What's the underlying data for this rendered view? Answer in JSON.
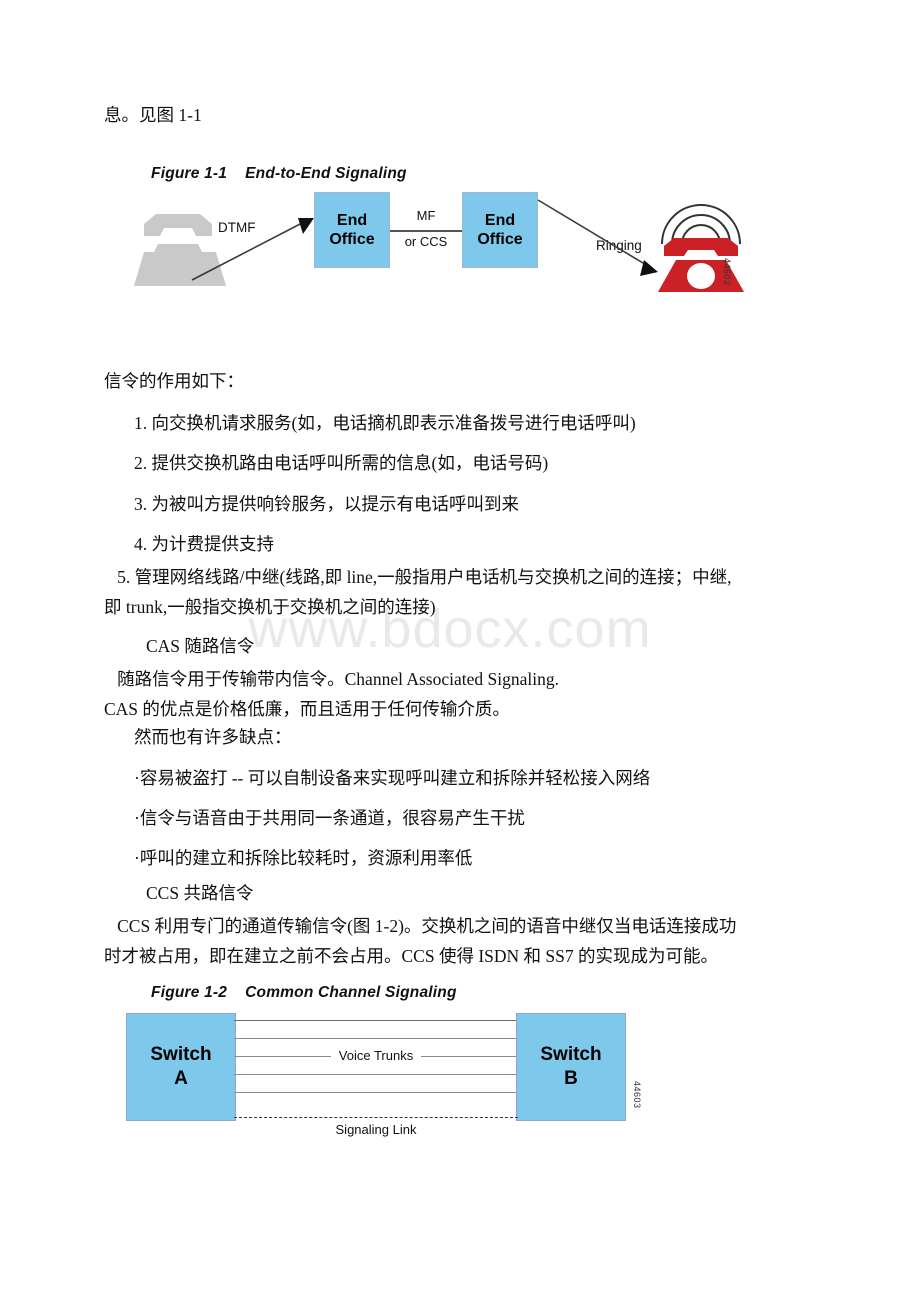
{
  "document": {
    "watermark": "www.bdocx.com",
    "paragraphs": [
      {
        "id": "p-intro",
        "text": "息。见图 1-1"
      },
      {
        "id": "p-roles-heading",
        "text": "信令的作用如下："
      },
      {
        "id": "p-role-1",
        "text": "1. 向交换机请求服务(如，电话摘机即表示准备拨号进行电话呼叫)"
      },
      {
        "id": "p-role-2",
        "text": "2. 提供交换机路由电话呼叫所需的信息(如，电话号码)"
      },
      {
        "id": "p-role-3",
        "text": "3. 为被叫方提供响铃服务，以提示有电话呼叫到来"
      },
      {
        "id": "p-role-4",
        "text": "4. 为计费提供支持"
      },
      {
        "id": "p-role-5",
        "text": "   5. 管理网络线路/中继(线路,即 line,一般指用户电话机与交换机之间的连接；中继,\n即 trunk,一般指交换机于交换机之间的连接)"
      },
      {
        "id": "p-cas-heading",
        "text": "CAS 随路信令"
      },
      {
        "id": "p-cas-body",
        "text": "   随路信令用于传输带内信令。Channel Associated Signaling.\nCAS 的优点是价格低廉，而且适用于任何传输介质。"
      },
      {
        "id": "p-drawbacks-heading",
        "text": "然而也有许多缺点："
      },
      {
        "id": "p-drawback-1",
        "text": "·容易被盗打 -- 可以自制设备来实现呼叫建立和拆除并轻松接入网络"
      },
      {
        "id": "p-drawback-2",
        "text": "·信令与语音由于共用同一条通道，很容易产生干扰"
      },
      {
        "id": "p-drawback-3",
        "text": "·呼叫的建立和拆除比较耗时，资源利用率低"
      },
      {
        "id": "p-ccs-heading",
        "text": "CCS 共路信令"
      },
      {
        "id": "p-ccs-body",
        "text": "   CCS 利用专门的通道传输信令(图 1-2)。交换机之间的语音中继仅当电话连接成功\n时才被占用，即在建立之前不会占用。CCS 使得 ISDN 和 SS7 的实现成为可能。"
      }
    ]
  },
  "figure1": {
    "caption_number": "Figure 1-1",
    "caption_title": "End-to-End Signaling",
    "figure_id": "44602",
    "nodes": [
      {
        "id": "end-office-1",
        "label_line1": "End",
        "label_line2": "Office"
      },
      {
        "id": "end-office-2",
        "label_line1": "End",
        "label_line2": "Office"
      }
    ],
    "links": {
      "dtmf": "DTMF",
      "mf": "MF",
      "or_ccs": "or CCS",
      "ringing": "Ringing"
    },
    "colors": {
      "box_fill": "#7ec8ec",
      "caller_phone": "#c9c9c9",
      "callee_phone": "#cc2027"
    }
  },
  "figure2": {
    "caption_number": "Figure 1-2",
    "caption_title": "Common Channel Signaling",
    "figure_id": "44603",
    "nodes": [
      {
        "id": "switch-a",
        "label_line1": "Switch",
        "label_line2": "A"
      },
      {
        "id": "switch-b",
        "label_line1": "Switch",
        "label_line2": "B"
      }
    ],
    "links": {
      "voice_trunks": "Voice Trunks",
      "signaling_link": "Signaling Link",
      "trunk_count": 5
    },
    "colors": {
      "box_fill": "#7ec8ec",
      "trunk_line": "#8c8c8c"
    }
  }
}
